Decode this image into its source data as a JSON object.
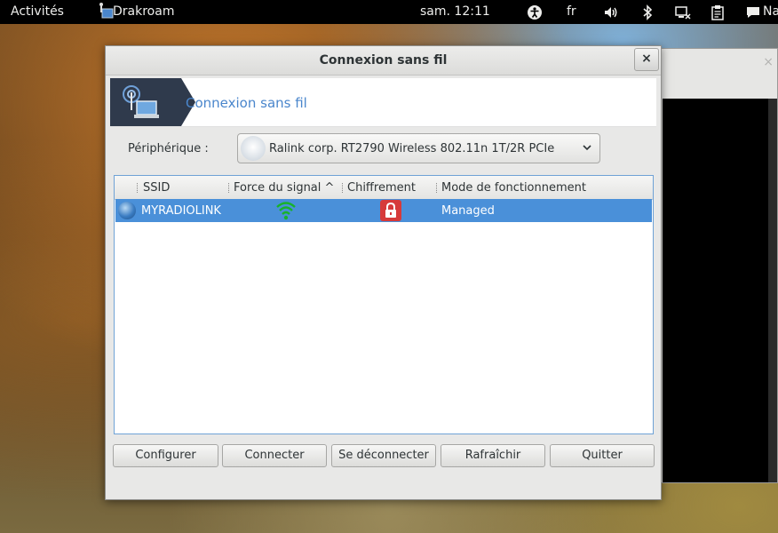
{
  "topbar": {
    "activities": "Activités",
    "app_name": "Drakroam",
    "clock": "sam. 12:11",
    "language": "fr",
    "right_cut_label": "Na",
    "icons": [
      "accessibility-icon",
      "volume-icon",
      "bluetooth-icon",
      "network-icon",
      "clipboard-icon",
      "chat-icon"
    ]
  },
  "background_window": {
    "close": "×"
  },
  "dialog": {
    "title": "Connexion sans fil",
    "close": "×",
    "banner_title": "Connexion sans fil",
    "device_label": "Périphérique :",
    "device_value": "Ralink corp. RT2790 Wireless 802.11n 1T/2R PCIe"
  },
  "list": {
    "columns": [
      "SSID",
      "Force du signal",
      "Chiffrement",
      "Mode de fonctionnement"
    ],
    "sort_indicator": "^",
    "rows": [
      {
        "ssid": "MYRADIOLINK",
        "signal": "full",
        "encryption": "locked",
        "mode": "Managed"
      }
    ]
  },
  "buttons": {
    "configure": "Configurer",
    "connect": "Connecter",
    "disconnect": "Se déconnecter",
    "refresh": "Rafraîchir",
    "quit": "Quitter"
  },
  "colors": {
    "selection": "#4a90d9",
    "link_blue": "#4a86cc",
    "signal_green": "#18b22a",
    "lock_red": "#d63a3a"
  }
}
